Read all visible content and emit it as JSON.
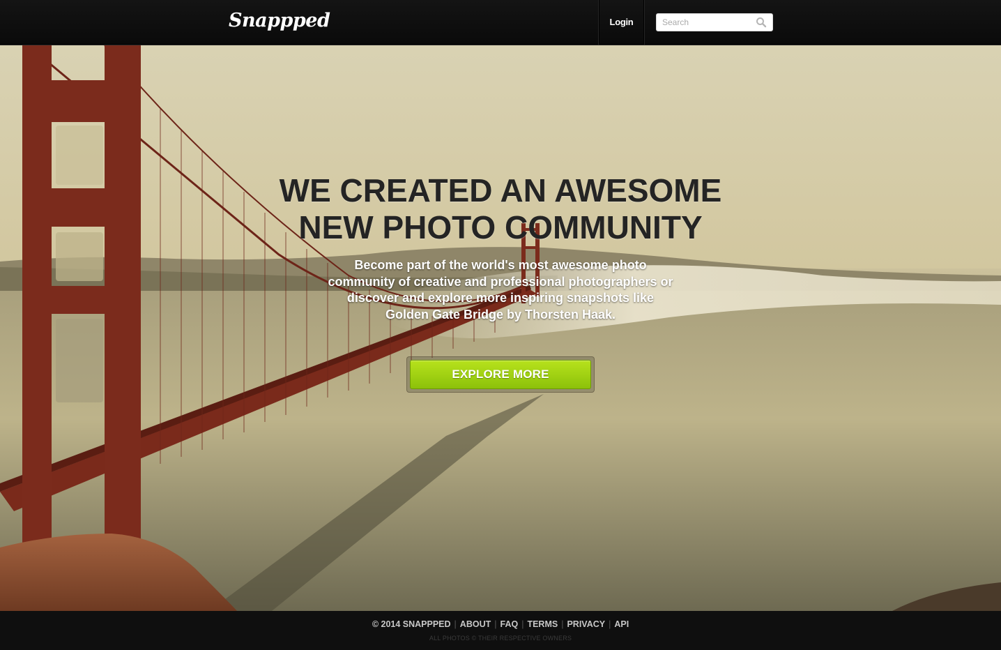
{
  "header": {
    "logo": "Snappped",
    "login_label": "Login",
    "search_placeholder": "Search",
    "search_value": ""
  },
  "hero": {
    "headline_line1": "WE CREATED AN AWESOME",
    "headline_line2": "NEW PHOTO COMMUNITY",
    "subtext": "Become part of the world's most awesome photo community of creative and professional photographers or discover and explore more inspiring snapshots like Golden Gate Bridge by Thorsten Haak.",
    "cta_label": "EXPLORE MORE"
  },
  "footer": {
    "copyright": "© 2014 SNAPPPED",
    "links": [
      "ABOUT",
      "FAQ",
      "TERMS",
      "PRIVACY",
      "API"
    ],
    "note": "ALL PHOTOS © THEIR RESPECTIVE OWNERS"
  },
  "colors": {
    "header_bg": "#0d0d0d",
    "cta_green": "#9ccf10",
    "bridge_red": "#7a2418"
  },
  "icons": {
    "search": "search-icon"
  }
}
